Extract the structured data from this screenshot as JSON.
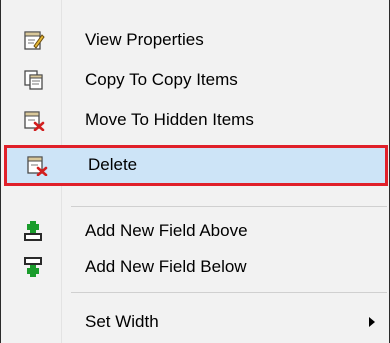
{
  "menu": {
    "items": [
      {
        "label": "View Properties",
        "icon": "view-properties-icon"
      },
      {
        "label": "Copy To Copy Items",
        "icon": "copy-items-icon"
      },
      {
        "label": "Move To Hidden Items",
        "icon": "move-hidden-icon"
      },
      {
        "label": "Delete",
        "icon": "delete-icon",
        "selected": true
      },
      {
        "label": "Add New Field Above",
        "icon": "add-field-above-icon"
      },
      {
        "label": "Add New Field Below",
        "icon": "add-field-below-icon"
      },
      {
        "label": "Set Width",
        "icon": "",
        "has_submenu": true
      }
    ],
    "colors": {
      "selection_fill": "#cde4f7",
      "highlight_border": "#e0202a",
      "menu_bg": "#f2f2f2"
    }
  }
}
